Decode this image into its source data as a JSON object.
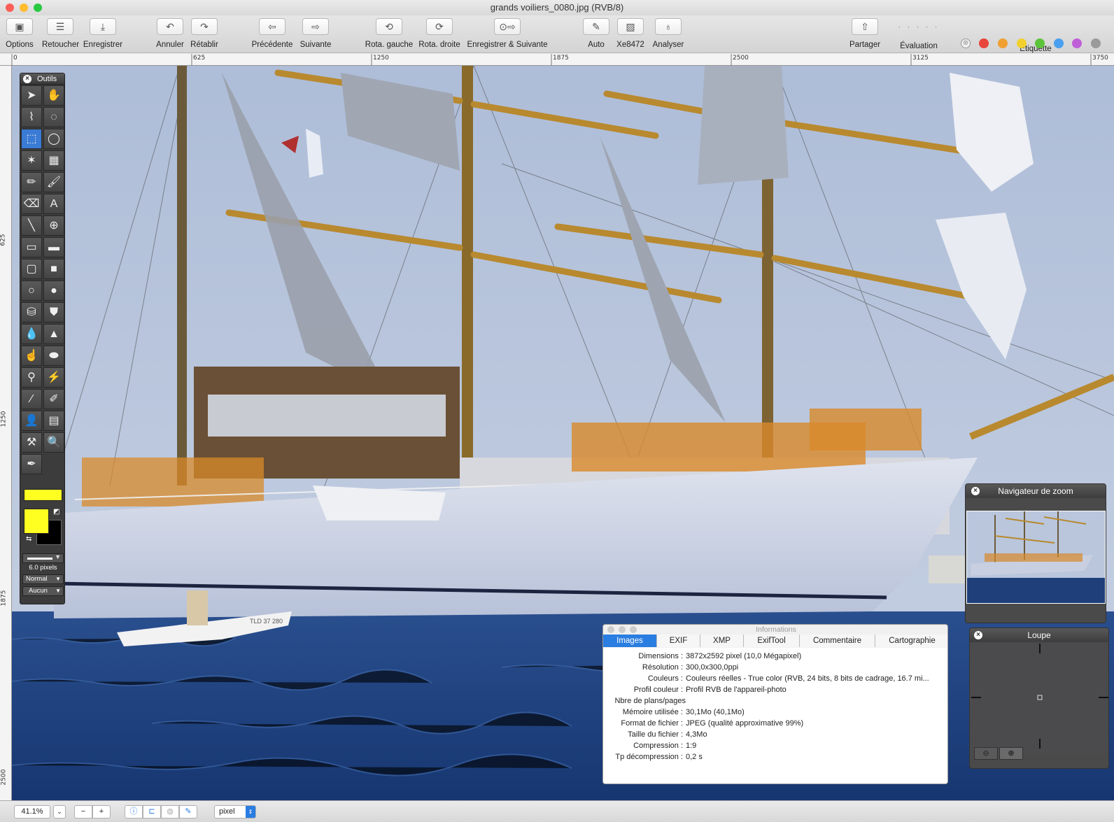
{
  "window": {
    "title": "grands voiliers_0080.jpg (RVB/8)"
  },
  "toolbar": {
    "options": "Options",
    "retoucher": "Retoucher",
    "enregistrer": "Enregistrer",
    "annuler": "Annuler",
    "retablir": "Rétablir",
    "precedente": "Précédente",
    "suivante": "Suivante",
    "rota_gauche": "Rota. gauche",
    "rota_droite": "Rota. droite",
    "enregistrer_suivante": "Enregistrer & Suivante",
    "auto": "Auto",
    "xe8472": "Xe8472",
    "analyser": "Analyser",
    "partager": "Partager",
    "evaluation": "Évaluation",
    "etiquette": "Étiquette",
    "rating_dots": "· · · · ·",
    "label_colors": [
      "#e8453c",
      "#f0a030",
      "#f2d02e",
      "#5cc43a",
      "#4aa0f0",
      "#c060d8",
      "#9a9a9a"
    ]
  },
  "ruler": {
    "top_ticks": [
      "0",
      "625",
      "1250",
      "1875",
      "2500",
      "3125",
      "3750"
    ],
    "left_ticks": [
      "625",
      "1250",
      "1875",
      "2500"
    ]
  },
  "tools_palette": {
    "title": "Outils",
    "size_label": "6.0 pixels",
    "mode_label": "Normal",
    "fill_label": "Aucun",
    "foreground_color": "#ffff22",
    "background_color": "#000000"
  },
  "zoom_navigator": {
    "title": "Navigateur de zoom"
  },
  "loupe": {
    "title": "Loupe"
  },
  "info_panel": {
    "title": "Informations",
    "tabs": [
      "Images",
      "EXIF",
      "XMP",
      "ExifTool",
      "Commentaire",
      "Cartographie"
    ],
    "rows": [
      {
        "k": "Dimensions :",
        "v": "3872x2592 pixel (10,0 Mégapixel)"
      },
      {
        "k": "Résolution :",
        "v": "300,0x300,0ppi"
      },
      {
        "k": "Couleurs :",
        "v": "Couleurs réelles - True color (RVB, 24 bits, 8 bits de cadrage, 16.7 mi..."
      },
      {
        "k": "Profil couleur :",
        "v": "Profil RVB de l'appareil-photo"
      },
      {
        "k": "Nbre de plans/pages",
        "v": ""
      },
      {
        "k": "Mémoire utilisée :",
        "v": "30,1Mo (40,1Mo)"
      },
      {
        "k": "Format de fichier :",
        "v": "JPEG (qualité approximative 99%)"
      },
      {
        "k": "Taille du fichier :",
        "v": "4,3Mo"
      },
      {
        "k": "Compression :",
        "v": "1:9"
      },
      {
        "k": "Tp décompression :",
        "v": "0,2 s"
      }
    ]
  },
  "image": {
    "boat_hull_text": "TLD 37 280"
  },
  "statusbar": {
    "zoom": "41.1%",
    "minus": "−",
    "plus": "+",
    "unit": "pixel"
  }
}
